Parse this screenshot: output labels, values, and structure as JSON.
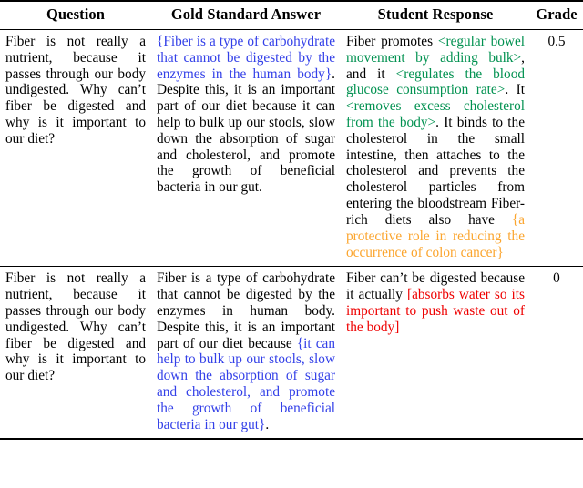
{
  "table": {
    "headers": {
      "question": "Question",
      "gold": "Gold Standard Answer",
      "student": "Student Response",
      "grade": "Grade"
    },
    "colors": {
      "blue": "#3340e8",
      "green": "#019150",
      "orange": "#fba52e",
      "red": "#ee0000",
      "text": "#000000",
      "rule": "#000000"
    },
    "rows": [
      {
        "question": "Fiber is not really a nutrient, because it passes through our body undigested. Why can’t fiber be digested and why is it important to our diet?",
        "gold_segments": [
          {
            "color": "blue",
            "text": "{Fiber is a type of carbohydrate that cannot be digested by the enzymes in the human body}"
          },
          {
            "color": "black",
            "text": ". Despite this, it is an important part of our diet because it can help to bulk up our stools, slow down the absorption of sugar and cholesterol, and promote the growth of beneficial bacteria in our gut."
          }
        ],
        "student_segments": [
          {
            "color": "black",
            "text": "Fiber promotes "
          },
          {
            "color": "green",
            "text": "<regular bowel movement by adding bulk>"
          },
          {
            "color": "black",
            "text": ", and it "
          },
          {
            "color": "green",
            "text": "<regulates the blood glucose consumption rate>"
          },
          {
            "color": "black",
            "text": ".  It "
          },
          {
            "color": "green",
            "text": "<removes excess cholesterol from the body>"
          },
          {
            "color": "black",
            "text": ". It binds to the cholesterol in the small intestine, then attaches to the cholesterol and prevents the cholesterol particles from entering the bloodstream Fiber-rich diets also have "
          },
          {
            "color": "orange",
            "text": "{a protective role in reducing the occurrence of colon cancer}"
          }
        ],
        "grade": "0.5"
      },
      {
        "question": "Fiber is not really a nutrient, because it passes through our body undigested. Why can’t fiber be digested and why is it important to our diet?",
        "gold_segments": [
          {
            "color": "black",
            "text": "Fiber is a type of carbohydrate that cannot be digested by the enzymes in human body.  Despite this, it is an important part of our diet because "
          },
          {
            "color": "blue",
            "text": "{it can help to bulk up our stools, slow down the absorption of sugar and cholesterol, and promote the growth of beneficial bacteria in our gut}"
          },
          {
            "color": "black",
            "text": "."
          }
        ],
        "student_segments": [
          {
            "color": "black",
            "text": "Fiber can’t be digested because it actually "
          },
          {
            "color": "red",
            "text": "[absorbs water so its important to push waste out of the body]"
          }
        ],
        "grade": "0"
      }
    ]
  }
}
